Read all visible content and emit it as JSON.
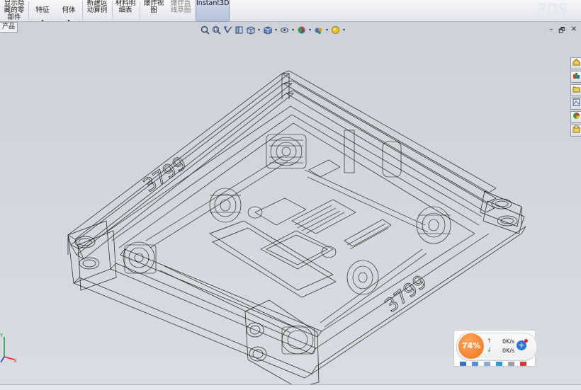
{
  "ribbon": {
    "show_hidden_parts": "显示隐\n藏的零\n部件",
    "features": "特征",
    "geometry": "何体",
    "new_motion_study": "新建运\n动算例",
    "bom": "材料明\n细表",
    "exploded_view": "爆炸视\n图",
    "explode_line_sketch": "爆炸直\n线草图",
    "instant3d": "Instant3D",
    "dropdown_caret": "▾"
  },
  "tree_tab": {
    "label": "产品"
  },
  "window_controls": {
    "minimize": "–",
    "restore": "🗗",
    "close": "✕"
  },
  "model": {
    "label_left": "3799",
    "label_right": "3799"
  },
  "triad": {
    "y_label": "Y",
    "x_label": "X"
  },
  "net_widget": {
    "percent": "74%",
    "up_rate": "0K/s",
    "down_rate": "0K/s",
    "up_arrow": "↑",
    "down_arrow": "↓",
    "plus": "+"
  }
}
